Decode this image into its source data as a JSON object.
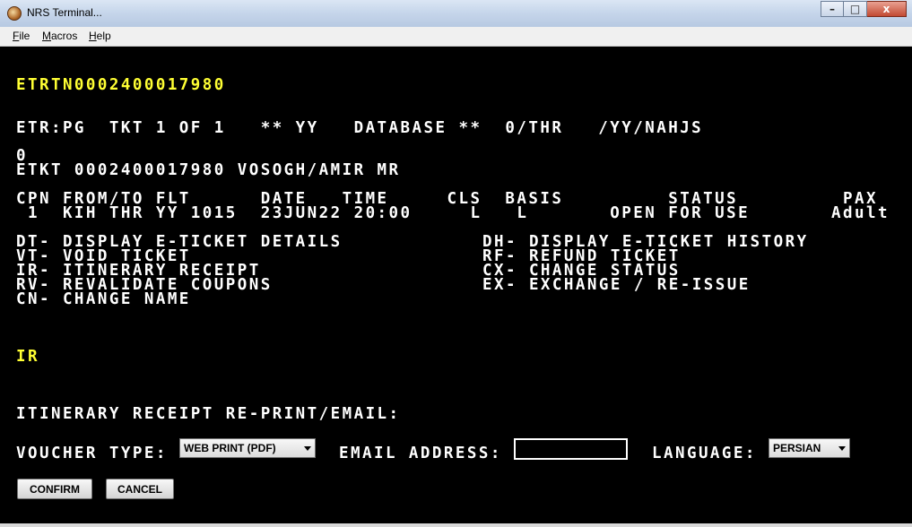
{
  "window": {
    "title": "NRS Terminal...",
    "minimize": "–",
    "maximize": "□",
    "close": "x"
  },
  "menu": {
    "file_u": "F",
    "file_rest": "ile",
    "macros_u": "M",
    "macros_rest": "acros",
    "help_u": "H",
    "help_rest": "elp"
  },
  "terminal": {
    "ticket_ref": "ETRTN0002400017980",
    "etr_header": "ETR:PG  TKT 1 OF 1   ** YY   DATABASE **  0/THR   /YY/NAHJS",
    "zero": "0",
    "etkt_line": "ETKT 0002400017980 VOSOGH/AMIR MR",
    "coupon_header": "CPN FROM/TO FLT      DATE   TIME     CLS  BASIS         STATUS         PAX",
    "coupon_row": " 1  KIH THR YY 1015  23JUN22 20:00     L   L       OPEN FOR USE       Adult",
    "options_left": [
      "DT- DISPLAY E-TICKET DETAILS",
      "VT- VOID TICKET",
      "IR- ITINERARY RECEIPT",
      "RV- REVALIDATE COUPONS",
      "CN- CHANGE NAME"
    ],
    "options_right": [
      "DH- DISPLAY E-TICKET HISTORY",
      "RF- REFUND TICKET",
      "CX- CHANGE STATUS",
      "EX- EXCHANGE / RE-ISSUE"
    ],
    "command": "IR",
    "section_title": "ITINERARY RECEIPT RE-PRINT/EMAIL:"
  },
  "form": {
    "voucher_label": "VOUCHER TYPE:",
    "voucher_value": "WEB PRINT (PDF)",
    "email_label": "EMAIL ADDRESS:",
    "email_value": "",
    "language_label": "LANGUAGE:",
    "language_value": "PERSIAN",
    "confirm_label": "CONFIRM",
    "cancel_label": "CANCEL"
  }
}
